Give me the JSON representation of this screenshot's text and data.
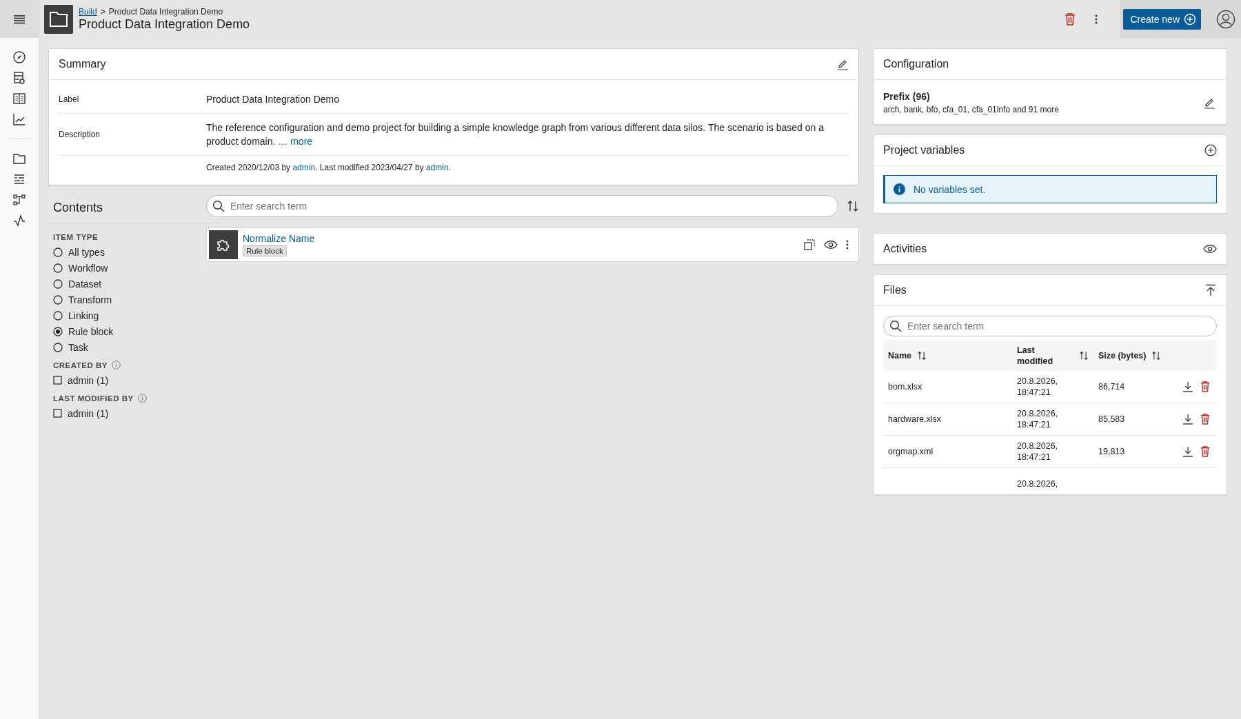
{
  "header": {
    "breadcrumb_separator": ">",
    "breadcrumb": [
      {
        "label": "Build",
        "kind": "link"
      },
      {
        "label": "Product Data Integration Demo",
        "kind": "current"
      }
    ],
    "title": "Product Data Integration Demo",
    "create_button": "Create new"
  },
  "summary": {
    "title": "Summary",
    "rows": [
      {
        "label": "Label",
        "value": "Product Data Integration Demo"
      },
      {
        "label": "Description",
        "value": "The reference configuration and demo project for building a simple knowledge graph from various different data silos. The scenario is based on a product domain. …",
        "more": "more"
      }
    ],
    "meta": [
      {
        "kind": "text",
        "text": "Created 2020/12/03 by"
      },
      {
        "kind": "link",
        "text": "admin"
      },
      {
        "kind": "text",
        "text": ". Last modified 2023/04/27 by"
      },
      {
        "kind": "link",
        "text": "admin"
      },
      {
        "kind": "text",
        "text": "."
      }
    ]
  },
  "contents": {
    "title": "Contents",
    "search_placeholder": "Enter search term",
    "filters": [
      {
        "title": "ITEM TYPE",
        "kind": "radio",
        "info": false,
        "options": [
          {
            "label": "All types",
            "selected": false
          },
          {
            "label": "Workflow",
            "selected": false
          },
          {
            "label": "Dataset",
            "selected": false
          },
          {
            "label": "Transform",
            "selected": false
          },
          {
            "label": "Linking",
            "selected": false
          },
          {
            "label": "Rule block",
            "selected": true
          },
          {
            "label": "Task",
            "selected": false
          }
        ]
      },
      {
        "title": "CREATED BY",
        "kind": "checkbox",
        "info": true,
        "options": [
          {
            "label": "admin (1)",
            "checked": false
          }
        ]
      },
      {
        "title": "LAST MODIFIED BY",
        "kind": "checkbox",
        "info": true,
        "options": [
          {
            "label": "admin (1)",
            "checked": false
          }
        ]
      }
    ],
    "items": [
      {
        "name": "Normalize Name",
        "tag": "Rule block"
      }
    ]
  },
  "configuration": {
    "title": "Configuration",
    "prefix_title": "Prefix (96)",
    "prefix_list": "arch, bank, bfo, cfa_01, cfa_01info and 91 more"
  },
  "project_variables": {
    "title": "Project variables",
    "message": "No variables set."
  },
  "activities": {
    "title": "Activities"
  },
  "files": {
    "title": "Files",
    "search_placeholder": "Enter search term",
    "columns": [
      "Name",
      "Last modified",
      "Size (bytes)"
    ],
    "rows": [
      {
        "name": "bom.xlsx",
        "modified": "20.8.2026, 18:47:21",
        "size": "86,714"
      },
      {
        "name": "hardware.xlsx",
        "modified": "20.8.2026, 18:47:21",
        "size": "85,583"
      },
      {
        "name": "orgmap.xml",
        "modified": "20.8.2026, 18:47:21",
        "size": "19,813"
      },
      {
        "modified": "20.8.2026,"
      }
    ]
  }
}
